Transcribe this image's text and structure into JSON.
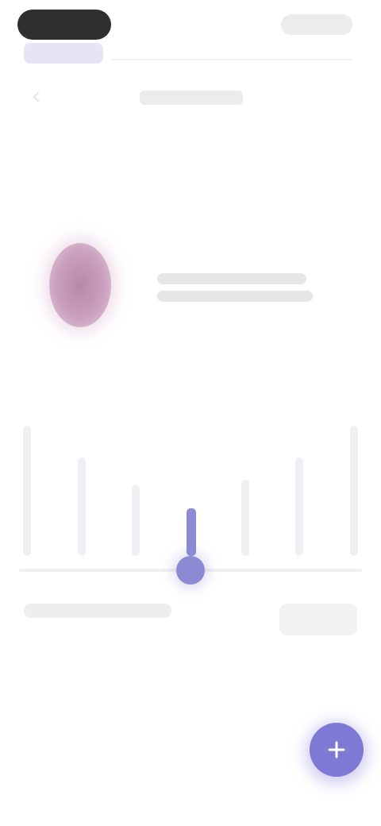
{
  "header": {
    "pill_label": "",
    "action_label": "",
    "subtitle": ""
  },
  "profile": {
    "line1": "",
    "line2": ""
  },
  "chart_data": {
    "type": "bar",
    "categories": [
      "",
      "",
      "",
      "",
      "",
      "",
      ""
    ],
    "values": [
      0.82,
      0.62,
      0.45,
      0.3,
      0.48,
      0.62,
      0.82
    ],
    "active_index": 3,
    "slider_level": 0.5,
    "colors": {
      "inactive": "#f0f0f4",
      "active": "#8e89d6"
    }
  },
  "labels": {
    "left": "",
    "right": ""
  },
  "fab": {
    "icon": "plus-icon",
    "color": "#7e79d4"
  }
}
